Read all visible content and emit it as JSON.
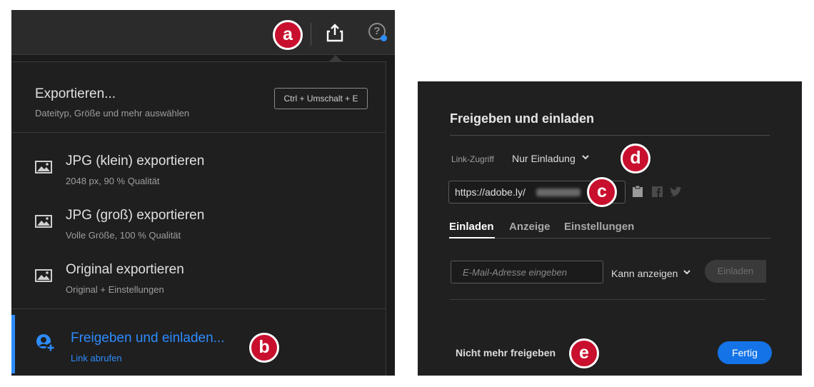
{
  "left_panel": {
    "export": {
      "title": "Exportieren...",
      "subtitle": "Dateityp, Größe und mehr auswählen",
      "shortcut": "Ctrl + Umschalt + E"
    },
    "export_items": [
      {
        "title": "JPG (klein) exportieren",
        "subtitle": "2048 px, 90 % Qualität",
        "icon": "image-icon"
      },
      {
        "title": "JPG (groß) exportieren",
        "subtitle": "Volle Größe, 100 % Qualität",
        "icon": "image-icon"
      },
      {
        "title": "Original exportieren",
        "subtitle": "Original + Einstellungen",
        "icon": "image-icon"
      }
    ],
    "share": {
      "title": "Freigeben und einladen...",
      "subtitle": "Link abrufen",
      "icon": "person-add-icon"
    },
    "toolbar_icons": [
      "share-icon",
      "help-icon"
    ],
    "help_icon_glyph": "?"
  },
  "right_panel": {
    "title": "Freigeben und einladen",
    "link_access_label": "Link-Zugriff",
    "link_access_value": "Nur Einladung",
    "link_url": "https://adobe.ly/",
    "tabs": [
      "Einladen",
      "Anzeige",
      "Einstellungen"
    ],
    "active_tab": "Einladen",
    "email_placeholder": "E-Mail-Adresse eingeben",
    "permission_value": "Kann anzeigen",
    "invite_label": "Einladen",
    "stop_sharing_label": "Nicht mehr freigeben",
    "done_label": "Fertig"
  },
  "markers": {
    "a": "a",
    "b": "b",
    "c": "c",
    "d": "d",
    "e": "e"
  },
  "colors": {
    "accent": "#2d8cff",
    "marker": "#c8102e",
    "done_button": "#1473e6"
  }
}
